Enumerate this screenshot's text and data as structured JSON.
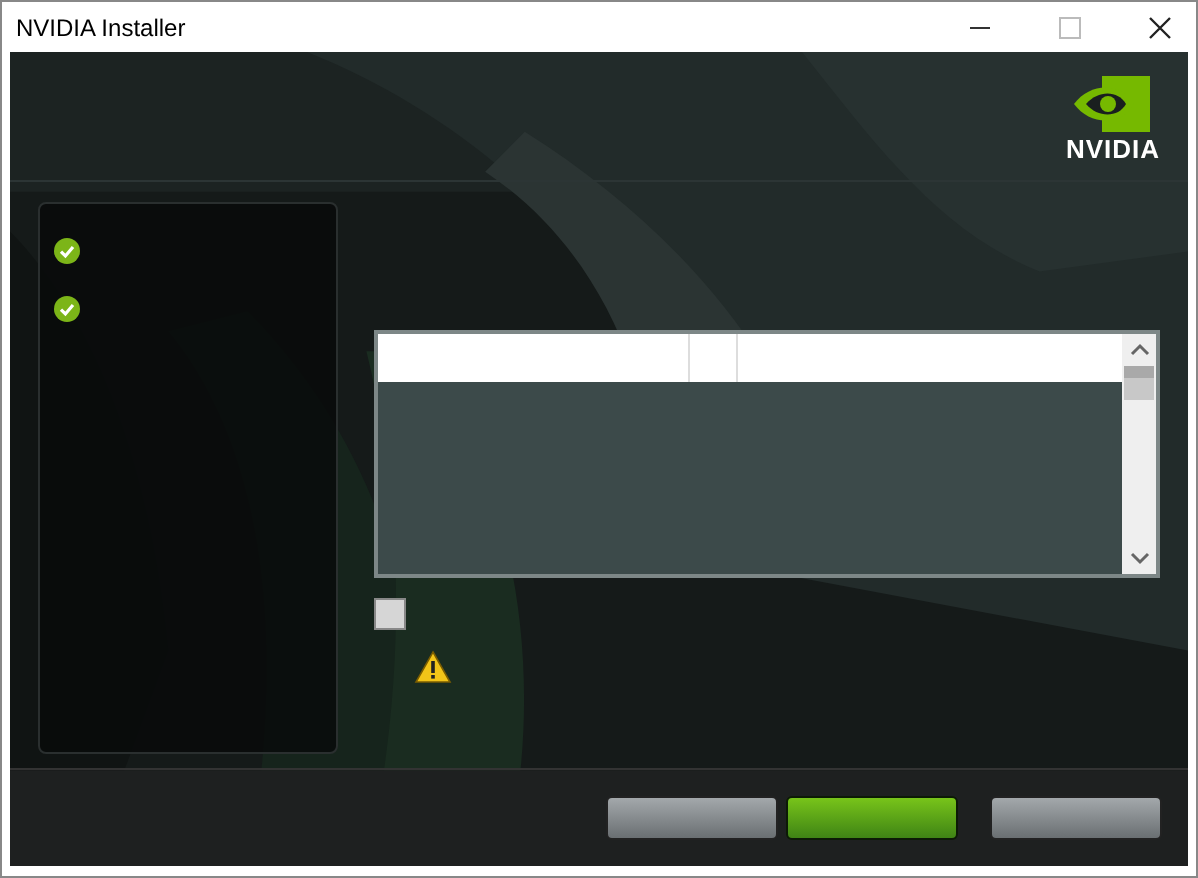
{
  "window": {
    "title": "NVIDIA Installer"
  },
  "header": {
    "logo_text": "NVIDIA"
  },
  "steps": [
    {
      "done": true
    },
    {
      "done": true
    }
  ],
  "checkbox": {
    "checked": false
  },
  "warning": {
    "shown": true
  },
  "buttons": [
    {
      "kind": "secondary"
    },
    {
      "kind": "primary"
    },
    {
      "kind": "secondary"
    }
  ]
}
